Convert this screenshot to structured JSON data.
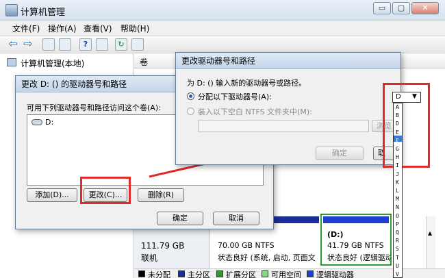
{
  "window": {
    "title": "计算机管理",
    "minimize": "▭",
    "restore": "▢",
    "close": "✕"
  },
  "menu": [
    "文件(F)",
    "操作(A)",
    "查看(V)",
    "帮助(H)"
  ],
  "tree": {
    "root": "计算机管理(本地)"
  },
  "column": {
    "volume": "卷"
  },
  "dlg_main": {
    "title": "更改 D: () 的驱动器号和路径",
    "prompt": "可用下列驱动器号和路径访问这个卷(A):",
    "entry": "D:",
    "add": "添加(D)...",
    "change": "更改(C)...",
    "remove": "删除(R)",
    "ok": "确定",
    "cancel": "取消"
  },
  "dlg_change": {
    "title": "更改驱动器号和路径",
    "desc": "为 D: () 输入新的驱动器号或路径。",
    "radio_assign": "分配以下驱动器号(A):",
    "radio_mount": "装入以下空白 NTFS 文件夹中(M):",
    "browse": "浏览",
    "ok": "确定",
    "cancel": "取",
    "selected_letter": "D",
    "letters": [
      "A",
      "B",
      "D",
      "E",
      "F",
      "G",
      "H",
      "I",
      "J",
      "K",
      "L",
      "M",
      "N",
      "O",
      "P",
      "Q",
      "R",
      "S",
      "T",
      "U",
      "V"
    ],
    "highlighted_letter": "F"
  },
  "disks": {
    "disk0": {
      "size": "111.79 GB",
      "status": "联机"
    },
    "c": {
      "size": "70.00 GB NTFS",
      "status": "状态良好 (系统, 启动, 页面文"
    },
    "d": {
      "name": "(D:)",
      "size": "41.79 GB NTFS",
      "status": "状态良好 (逻辑驱动"
    }
  },
  "legend": [
    "未分配",
    "主分区",
    "扩展分区",
    "可用空间",
    "逻辑驱动器"
  ],
  "colors": {
    "unalloc": "#000000",
    "primary": "#1a2e9a",
    "extended": "#2f9a2f",
    "free": "#7ddc7d",
    "logical": "#1e3fd0",
    "highlight": "#3a78d8",
    "accent_red": "#e02a2a"
  }
}
